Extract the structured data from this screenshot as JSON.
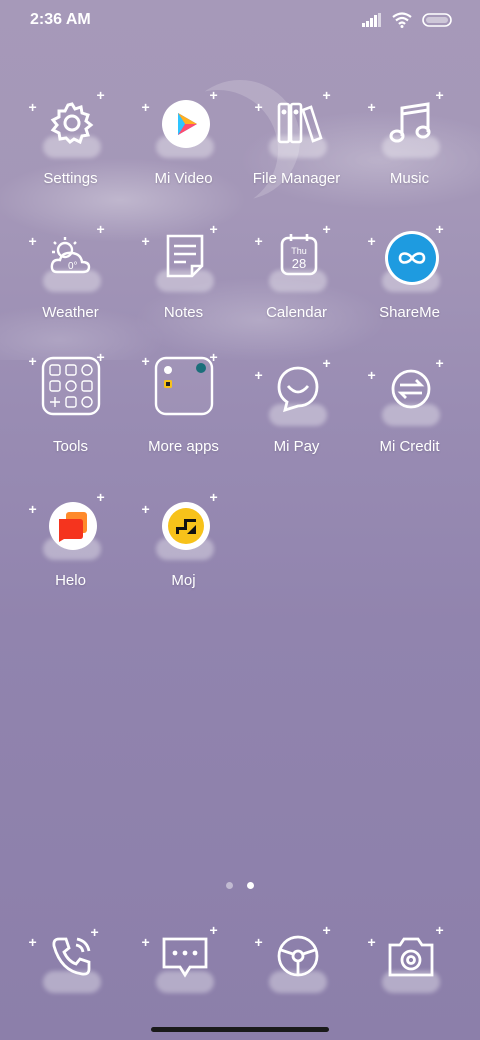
{
  "status_bar": {
    "time": "2:36 AM",
    "icons": [
      "signal-icon",
      "wifi-icon",
      "battery-icon"
    ]
  },
  "apps": [
    {
      "label": "Settings",
      "icon": "gear-icon"
    },
    {
      "label": "Mi Video",
      "icon": "play-icon"
    },
    {
      "label": "File Manager",
      "icon": "folder-icon"
    },
    {
      "label": "Music",
      "icon": "music-note-icon"
    },
    {
      "label": "Weather",
      "icon": "weather-icon",
      "icon_text": "0°"
    },
    {
      "label": "Notes",
      "icon": "notes-icon"
    },
    {
      "label": "Calendar",
      "icon": "calendar-icon",
      "icon_day": "Thu",
      "icon_date": "28"
    },
    {
      "label": "ShareMe",
      "icon": "shareme-icon"
    },
    {
      "label": "Tools",
      "icon": "tools-folder-icon"
    },
    {
      "label": "More apps",
      "icon": "more-apps-folder-icon"
    },
    {
      "label": "Mi Pay",
      "icon": "mi-pay-icon"
    },
    {
      "label": "Mi Credit",
      "icon": "mi-credit-icon"
    },
    {
      "label": "Helo",
      "icon": "helo-icon"
    },
    {
      "label": "Moj",
      "icon": "moj-icon"
    }
  ],
  "page_indicator": {
    "pages": 2,
    "current": 2
  },
  "dock": [
    {
      "icon": "phone-icon"
    },
    {
      "icon": "messages-icon"
    },
    {
      "icon": "browser-icon"
    },
    {
      "icon": "camera-icon"
    }
  ],
  "colors": {
    "background": "#9a8db3",
    "shareme_blue": "#1e9be0",
    "helo_orange": "#f5541e",
    "moj_yellow": "#f7c21a"
  }
}
